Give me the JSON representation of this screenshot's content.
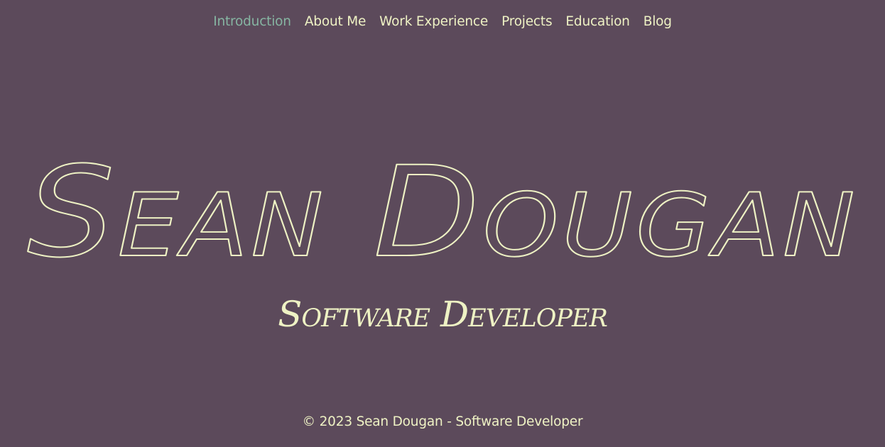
{
  "nav": {
    "items": [
      {
        "label": "Introduction",
        "active": true
      },
      {
        "label": "About Me",
        "active": false
      },
      {
        "label": "Work Experience",
        "active": false
      },
      {
        "label": "Projects",
        "active": false
      },
      {
        "label": "Education",
        "active": false
      },
      {
        "label": "Blog",
        "active": false
      }
    ]
  },
  "hero": {
    "name": "Sean Dougan",
    "subtitle": "Software Developer"
  },
  "footer": {
    "text": "© 2023 Sean Dougan - Software Developer"
  },
  "colors": {
    "background": "#5c4a5b",
    "text": "#eef2c4",
    "active_nav": "#86b5a2"
  }
}
